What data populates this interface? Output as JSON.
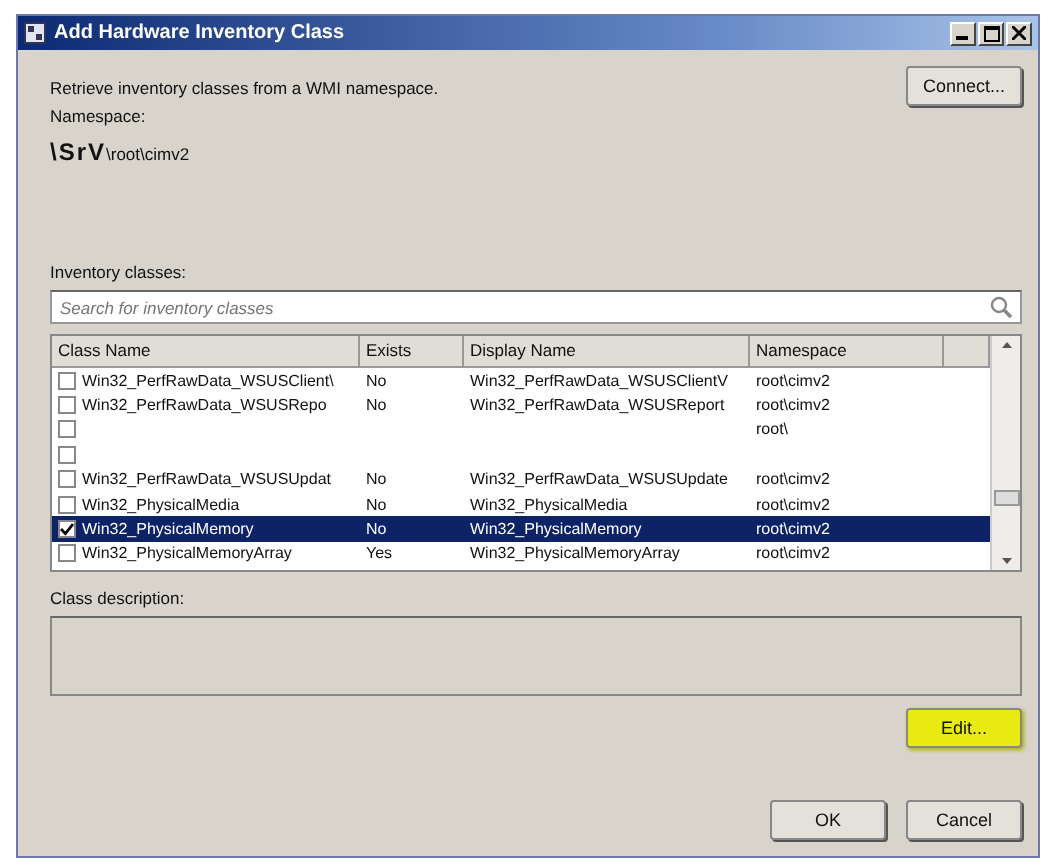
{
  "window": {
    "title": "Add Hardware Inventory Class"
  },
  "intro": "Retrieve inventory classes from a WMI namespace.",
  "connect_button": "Connect...",
  "namespace": {
    "label": "Namespace:",
    "server": "\\SrV",
    "path": "\\root\\cimv2"
  },
  "inventory_classes": {
    "label": "Inventory classes:",
    "search": {
      "placeholder": "Search for inventory classes"
    }
  },
  "table": {
    "columns": [
      "Class Name",
      "Exists",
      "Display Name",
      "Namespace"
    ],
    "rows": [
      {
        "checked": false,
        "selected": false,
        "cells": [
          "Win32_PerfRawData_WSUSClient\\",
          "No",
          "Win32_PerfRawData_WSUSClientV",
          "root\\cimv2"
        ]
      },
      {
        "checked": false,
        "selected": false,
        "cells": [
          "Win32_PerfRawData_WSUSRepo",
          "No",
          "Win32_PerfRawData_WSUSReport",
          "root\\cimv2"
        ]
      },
      {
        "checked": false,
        "selected": false,
        "cells": [
          "",
          "",
          "",
          "root\\"
        ]
      },
      {
        "checked": false,
        "selected": false,
        "cells": [
          "",
          "",
          "",
          ""
        ]
      },
      {
        "checked": false,
        "selected": false,
        "cells": [
          "Win32_PerfRawData_WSUSUpdat",
          "No",
          "Win32_PerfRawData_WSUSUpdate",
          "root\\cimv2"
        ]
      },
      {
        "checked": false,
        "selected": false,
        "cells": [
          "Win32_PhysicalMedia",
          "No",
          "Win32_PhysicalMedia",
          "root\\cimv2"
        ]
      },
      {
        "checked": true,
        "selected": true,
        "cells": [
          "Win32_PhysicalMemory",
          "No",
          "Win32_PhysicalMemory",
          "root\\cimv2"
        ]
      },
      {
        "checked": false,
        "selected": false,
        "cells": [
          "Win32_PhysicalMemoryArray",
          "Yes",
          "Win32_PhysicalMemoryArray",
          "root\\cimv2"
        ]
      }
    ]
  },
  "class_description": {
    "label": "Class description:"
  },
  "edit_button": {
    "label": "Edit...",
    "highlighted": true
  },
  "buttons": [
    "OK",
    "Cancel"
  ]
}
